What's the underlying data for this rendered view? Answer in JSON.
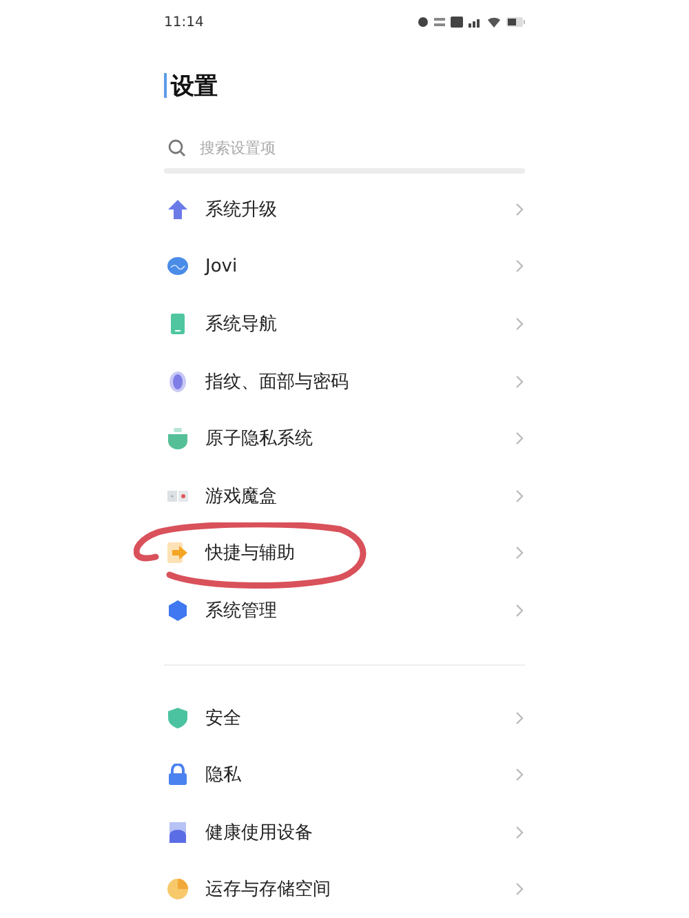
{
  "status_bar": {
    "time": "11:14"
  },
  "title": "设置",
  "search": {
    "placeholder": "搜索设置项"
  },
  "sections": [
    {
      "items": [
        {
          "label": "系统升级",
          "circled": false
        },
        {
          "label": "Jovi",
          "circled": false
        },
        {
          "label": "系统导航",
          "circled": false
        },
        {
          "label": "指纹、面部与密码",
          "circled": false
        },
        {
          "label": "原子隐私系统",
          "circled": false
        },
        {
          "label": "游戏魔盒",
          "circled": false
        },
        {
          "label": "快捷与辅助",
          "circled": true
        },
        {
          "label": "系统管理",
          "circled": false
        }
      ]
    },
    {
      "items": [
        {
          "label": "安全",
          "circled": false
        },
        {
          "label": "隐私",
          "circled": false
        },
        {
          "label": "健康使用设备",
          "circled": false
        },
        {
          "label": "运存与存储空间",
          "circled": false
        }
      ]
    }
  ]
}
